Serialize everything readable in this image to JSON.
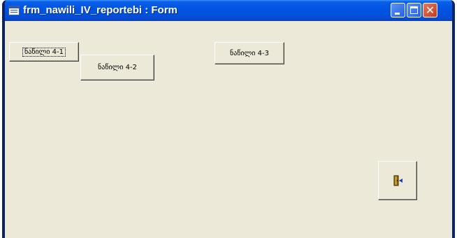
{
  "window": {
    "title": "frm_nawili_IV_reportebi : Form",
    "icon": "form-icon"
  },
  "titlebar_buttons": {
    "minimize_icon": "minimize-icon",
    "maximize_icon": "maximize-icon",
    "close_icon": "close-icon",
    "close_glyph": "✕"
  },
  "form": {
    "buttons": [
      {
        "label": "ნაწილი 4-1"
      },
      {
        "label": "ნაწილი 4-2"
      },
      {
        "label": "ნაწილი 4-3"
      }
    ],
    "exit_button": {
      "icon": "exit-door-icon"
    }
  },
  "colors": {
    "titlebar": "#0054e3",
    "form_background": "#ece9d8",
    "close_button": "#c13b1c"
  }
}
